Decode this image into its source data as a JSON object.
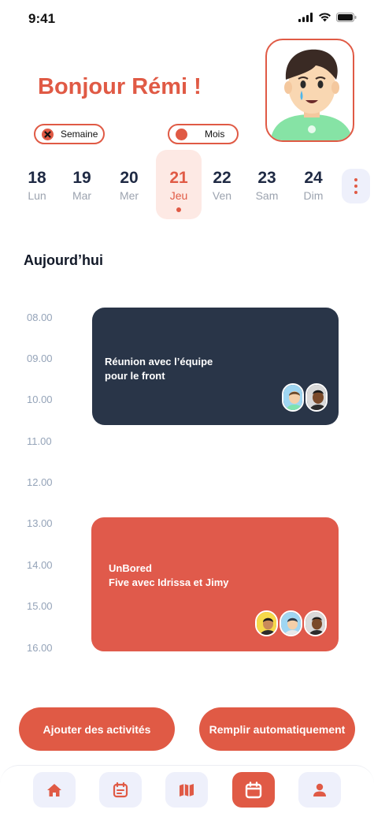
{
  "status_bar": {
    "time": "9:41"
  },
  "header": {
    "greeting": "Bonjour Rémi !"
  },
  "view_toggle": {
    "week_label": "Semaine",
    "month_label": "Mois"
  },
  "days": [
    {
      "num": "18",
      "name": "Lun"
    },
    {
      "num": "19",
      "name": "Mar"
    },
    {
      "num": "20",
      "name": "Mer"
    },
    {
      "num": "21",
      "name": "Jeu",
      "active": true
    },
    {
      "num": "22",
      "name": "Ven"
    },
    {
      "num": "23",
      "name": "Sam"
    },
    {
      "num": "24",
      "name": "Dim"
    }
  ],
  "schedule": {
    "title": "Aujourd’hui",
    "hours": [
      "08.00",
      "09.00",
      "10.00",
      "11.00",
      "12.00",
      "13.00",
      "14.00",
      "15.00",
      "16.00"
    ],
    "events": [
      {
        "line1": "Réunion avec l’équipe",
        "line2": "pour le front",
        "color": "#293548",
        "participants": 2
      },
      {
        "line1": "UnBored",
        "line2": "Five avec Idrissa et Jimy",
        "color": "#e05a4b",
        "participants": 3
      }
    ]
  },
  "actions": {
    "add_label": "Ajouter des activités",
    "fill_label": "Remplir automatiquement"
  },
  "bottom_nav": [
    "home-icon",
    "agenda-icon",
    "map-icon",
    "calendar-icon",
    "profile-icon"
  ],
  "colors": {
    "accent": "#e05a45",
    "navy": "#293548",
    "active_day_bg": "#fde9e4"
  }
}
